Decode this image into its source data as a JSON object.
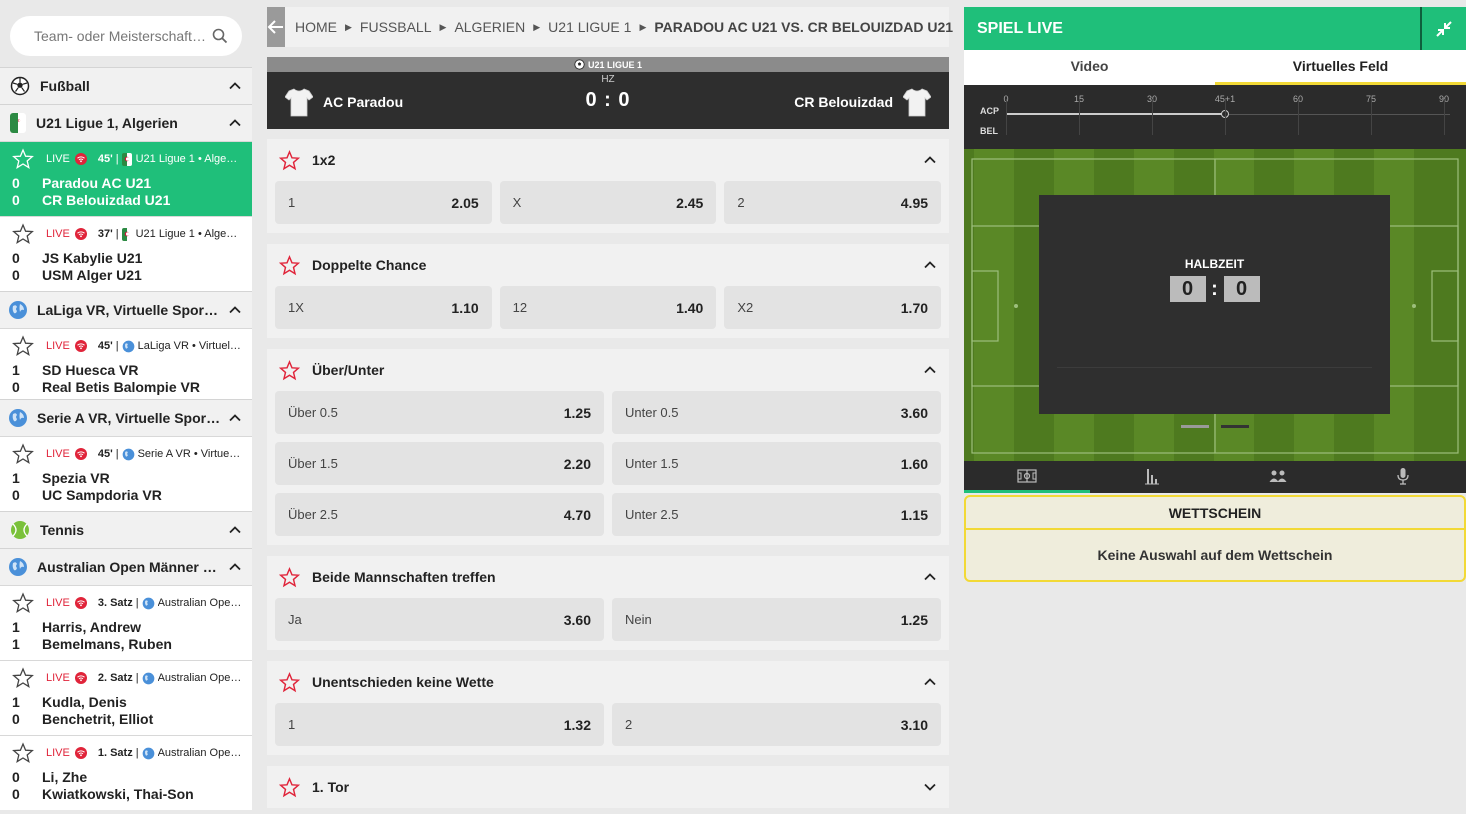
{
  "search": {
    "placeholder": "Team- oder Meisterschaft…"
  },
  "sidebar": {
    "soccer": {
      "label": "Fußball"
    },
    "u21": {
      "label": "U21 Ligue 1, Algerien"
    },
    "matches_u21": [
      {
        "live": "LIVE",
        "minute": "45'",
        "sep": "|",
        "comp": "U21 Ligue 1 • Alge…",
        "home_score": "0",
        "home": "Paradou AC U21",
        "away_score": "0",
        "away": "CR Belouizdad U21",
        "active": true
      },
      {
        "live": "LIVE",
        "minute": "37'",
        "sep": "|",
        "comp": "U21 Ligue 1 • Alge…",
        "home_score": "0",
        "home": "JS Kabylie U21",
        "away_score": "0",
        "away": "USM Alger U21"
      }
    ],
    "laliga": {
      "label": "LaLiga VR, Virtuelle Sport-L…"
    },
    "match_laliga": {
      "live": "LIVE",
      "minute": "45'",
      "sep": "|",
      "comp": "LaLiga VR • Virtuel…",
      "home_score": "1",
      "home": "SD Huesca VR",
      "away_score": "0",
      "away": "Real Betis Balompie VR"
    },
    "seriea": {
      "label": "Serie A VR, Virtuelle Sport-…"
    },
    "match_seriea": {
      "live": "LIVE",
      "minute": "45'",
      "sep": "|",
      "comp": "Serie A VR • Virtue…",
      "home_score": "1",
      "home": "Spezia VR",
      "away_score": "0",
      "away": "UC Sampdoria VR"
    },
    "tennis": {
      "label": "Tennis"
    },
    "ao": {
      "label": "Australian Open Männer Ein…"
    },
    "matches_ao": [
      {
        "live": "LIVE",
        "minute": "3. Satz",
        "sep": "|",
        "comp": "Australian Ope…",
        "home_score": "1",
        "home": "Harris, Andrew",
        "away_score": "1",
        "away": "Bemelmans, Ruben"
      },
      {
        "live": "LIVE",
        "minute": "2. Satz",
        "sep": "|",
        "comp": "Australian Ope…",
        "home_score": "1",
        "home": "Kudla, Denis",
        "away_score": "0",
        "away": "Benchetrit, Elliot"
      },
      {
        "live": "LIVE",
        "minute": "1. Satz",
        "sep": "|",
        "comp": "Australian Ope…",
        "home_score": "0",
        "home": "Li, Zhe",
        "away_score": "0",
        "away": "Kwiatkowski, Thai-Son"
      }
    ]
  },
  "breadcrumb": {
    "items": [
      "HOME",
      "FUSSBALL",
      "ALGERIEN",
      "U21 LIGUE 1"
    ],
    "current": "PARADOU AC U21 VS. CR BELOUIZDAD U21"
  },
  "scoreboard": {
    "league": "U21 LIGUE 1",
    "period": "HZ",
    "home": "AC Paradou",
    "away": "CR Belouizdad",
    "score": "0 : 0"
  },
  "markets": [
    {
      "title": "1x2",
      "rows": [
        [
          {
            "l": "1",
            "v": "2.05"
          },
          {
            "l": "X",
            "v": "2.45"
          },
          {
            "l": "2",
            "v": "4.95"
          }
        ]
      ]
    },
    {
      "title": "Doppelte Chance",
      "rows": [
        [
          {
            "l": "1X",
            "v": "1.10"
          },
          {
            "l": "12",
            "v": "1.40"
          },
          {
            "l": "X2",
            "v": "1.70"
          }
        ]
      ]
    },
    {
      "title": "Über/Unter",
      "rows": [
        [
          {
            "l": "Über 0.5",
            "v": "1.25"
          },
          {
            "l": "Unter 0.5",
            "v": "3.60"
          }
        ],
        [
          {
            "l": "Über 1.5",
            "v": "2.20"
          },
          {
            "l": "Unter 1.5",
            "v": "1.60"
          }
        ],
        [
          {
            "l": "Über 2.5",
            "v": "4.70"
          },
          {
            "l": "Unter 2.5",
            "v": "1.15"
          }
        ]
      ]
    },
    {
      "title": "Beide Mannschaften treffen",
      "rows": [
        [
          {
            "l": "Ja",
            "v": "3.60"
          },
          {
            "l": "Nein",
            "v": "1.25"
          }
        ]
      ]
    },
    {
      "title": "Unentschieden keine Wette",
      "rows": [
        [
          {
            "l": "1",
            "v": "1.32"
          },
          {
            "l": "2",
            "v": "3.10"
          }
        ]
      ]
    },
    {
      "title": "1. Tor",
      "rows": []
    }
  ],
  "live_panel": {
    "title": "SPIEL LIVE",
    "tabs": [
      "Video",
      "Virtuelles Feld"
    ],
    "timeline": {
      "ticks": [
        "0",
        "15",
        "30",
        "45+1",
        "60",
        "75",
        "90"
      ],
      "home": "ACP",
      "away": "BEL",
      "progress": 0.5
    },
    "overlay": {
      "title": "HALBZEIT",
      "home_score": "0",
      "away_score": "0"
    }
  },
  "betslip": {
    "title": "WETTSCHEIN",
    "empty": "Keine Auswahl auf dem Wettschein"
  },
  "colors": {
    "accent": "#1fbf7a",
    "live": "#e0243a",
    "slip_border": "#f2d936"
  }
}
